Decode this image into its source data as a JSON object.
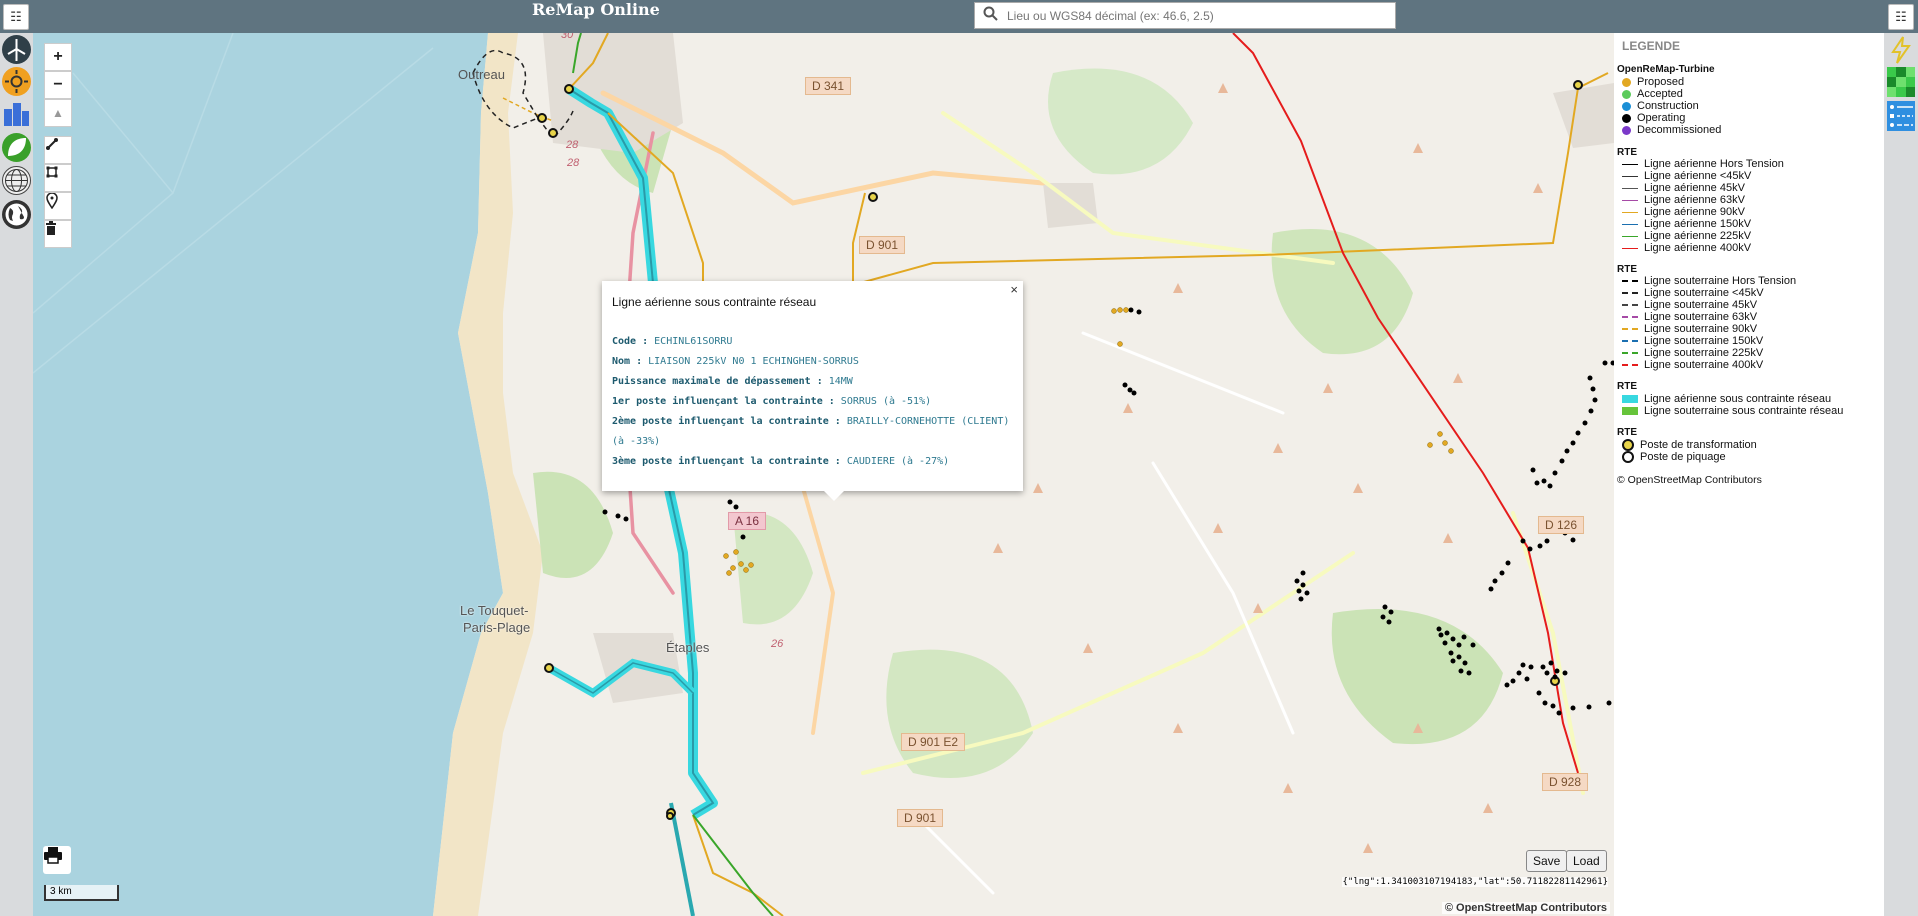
{
  "header": {
    "title": "ReMap Online",
    "search_placeholder": "Lieu ou WGS84 décimal (ex: 46.6, 2.5)"
  },
  "left_layers": [
    {
      "icon": "wind-turbine-icon"
    },
    {
      "icon": "sun-icon"
    },
    {
      "icon": "buildings-icon"
    },
    {
      "icon": "leaf-icon"
    },
    {
      "icon": "globe-grid-icon"
    },
    {
      "icon": "earth-icon"
    }
  ],
  "right_layers": [
    {
      "icon": "lightning-icon"
    },
    {
      "icon": "heatmap-grid-icon"
    },
    {
      "icon": "line-legend-icon"
    }
  ],
  "map": {
    "zoom_in": "+",
    "zoom_out": "−",
    "north": "▲",
    "scale": "3 km",
    "coords": "{\"lng\":1.341003107194183,\"lat\":50.71182281142961}",
    "attribution": "© OpenStreetMap Contributors",
    "save": "Save",
    "load": "Load",
    "place_labels": {
      "outreau": "Outreau",
      "touquet1": "Le Touquet-",
      "touquet2": "Paris-Plage",
      "etaples": "Étaples"
    },
    "road_labels": {
      "d341": "D 341",
      "d901a": "D 901",
      "d901e2": "D 901 E2",
      "d901b": "D 901",
      "d126": "D 126",
      "d928": "D 928",
      "a16": "A 16",
      "r28a": "28",
      "r28b": "28",
      "r26": "26",
      "r30": "30"
    }
  },
  "popup": {
    "title": "Ligne aérienne sous contrainte réseau",
    "close": "×",
    "rows": [
      {
        "label": "Code :",
        "value": "ECHINL61SORRU"
      },
      {
        "label": "Nom :",
        "value": "LIAISON 225kV N0 1 ECHINGHEN-SORRUS"
      },
      {
        "label": "Puissance maximale de dépassement :",
        "value": "14MW"
      },
      {
        "label": "1er poste influençant la contrainte :",
        "value": "SORRUS (à -51%)"
      },
      {
        "label": "2ème poste influençant la contrainte :",
        "value": "BRAILLY-CORNEHOTTE (CLIENT) (à -33%)"
      },
      {
        "label": "3ème poste influençant la contrainte :",
        "value": "CAUDIERE (à -27%)"
      }
    ]
  },
  "legend": {
    "title": "LEGENDE",
    "turbine": {
      "heading": "OpenReMap-Turbine",
      "items": [
        {
          "label": "Proposed",
          "color": "#e2a822"
        },
        {
          "label": "Accepted",
          "color": "#5ccb5c"
        },
        {
          "label": "Construction",
          "color": "#1b8fd6"
        },
        {
          "label": "Operating",
          "color": "#000000"
        },
        {
          "label": "Decommissioned",
          "color": "#7b39c9"
        }
      ]
    },
    "aerial": {
      "heading": "RTE",
      "items": [
        {
          "label": "Ligne aérienne Hors Tension",
          "color": "#000000"
        },
        {
          "label": "Ligne aérienne <45kV",
          "color": "#333333"
        },
        {
          "label": "Ligne aérienne 45kV",
          "color": "#555555"
        },
        {
          "label": "Ligne aérienne 63kV",
          "color": "#a64aa6"
        },
        {
          "label": "Ligne aérienne 90kV",
          "color": "#e2a822"
        },
        {
          "label": "Ligne aérienne 150kV",
          "color": "#1b6fb0"
        },
        {
          "label": "Ligne aérienne 225kV",
          "color": "#3aa62a"
        },
        {
          "label": "Ligne aérienne 400kV",
          "color": "#e51c1c"
        }
      ]
    },
    "underground": {
      "heading": "RTE",
      "items": [
        {
          "label": "Ligne souterraine Hors Tension",
          "color": "#000000"
        },
        {
          "label": "Ligne souterraine <45kV",
          "color": "#222222"
        },
        {
          "label": "Ligne souterraine 45kV",
          "color": "#444444"
        },
        {
          "label": "Ligne souterraine 63kV",
          "color": "#a64aa6"
        },
        {
          "label": "Ligne souterraine 90kV",
          "color": "#e2a822"
        },
        {
          "label": "Ligne souterraine 150kV",
          "color": "#1b6fb0"
        },
        {
          "label": "Ligne souterraine 225kV",
          "color": "#3aa62a"
        },
        {
          "label": "Ligne souterraine 400kV",
          "color": "#e51c1c"
        }
      ]
    },
    "constraint": {
      "items": [
        {
          "label": "Ligne aérienne sous contrainte réseau",
          "color": "#38d8e0"
        },
        {
          "label": "Ligne souterraine sous contrainte réseau",
          "color": "#66c43a"
        }
      ]
    },
    "posts": {
      "heading": "RTE",
      "items": [
        {
          "label": "Poste de transformation",
          "color": "#e0c22a"
        },
        {
          "label": "Poste de piquage",
          "color": "#222222"
        }
      ]
    },
    "copyright": "© OpenStreetMap Contributors"
  }
}
